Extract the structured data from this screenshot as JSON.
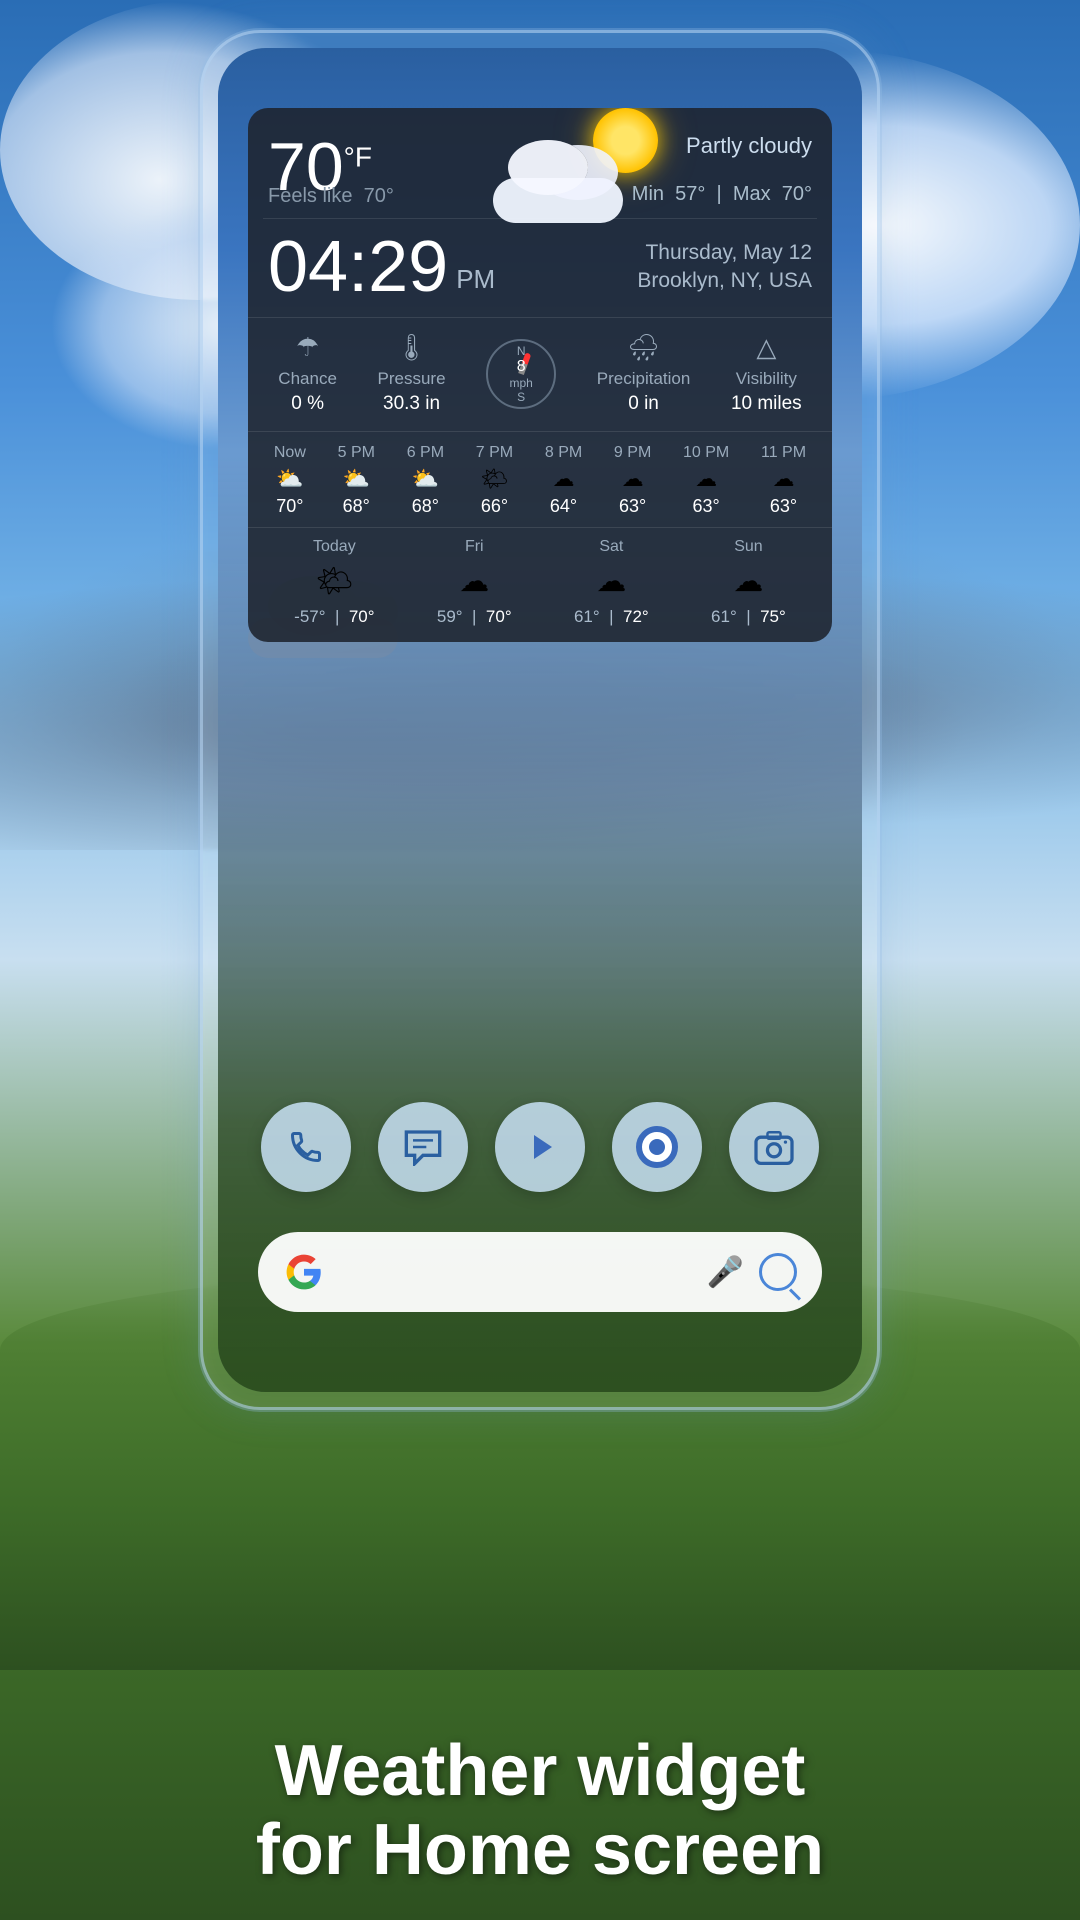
{
  "background": {
    "description": "Landscape with blue sky, clouds, and green hills"
  },
  "weather_widget": {
    "temperature": "70",
    "unit": "°F",
    "condition": "Partly cloudy",
    "feels_like_label": "Feels like",
    "feels_like_temp": "70°",
    "min_label": "Min",
    "min_temp": "57°",
    "max_label": "Max",
    "max_temp": "70°",
    "time": "04:29",
    "ampm": "PM",
    "date": "Thursday, May 12",
    "location": "Brooklyn, NY, USA",
    "stats": {
      "chance_label": "Chance",
      "chance_value": "0 %",
      "pressure_label": "Pressure",
      "pressure_value": "30.3 in",
      "wind_speed": "8",
      "wind_unit": "mph",
      "precipitation_label": "Precipitation",
      "precipitation_value": "0 in",
      "visibility_label": "Visibility",
      "visibility_value": "10 miles"
    },
    "hourly": [
      {
        "label": "Now",
        "icon": "⛅",
        "temp": "70°"
      },
      {
        "label": "5 PM",
        "icon": "⛅",
        "temp": "68°"
      },
      {
        "label": "6 PM",
        "icon": "⛅",
        "temp": "68°"
      },
      {
        "label": "7 PM",
        "icon": "🌤",
        "temp": "66°"
      },
      {
        "label": "8 PM",
        "icon": "☁",
        "temp": "64°"
      },
      {
        "label": "9 PM",
        "icon": "☁",
        "temp": "63°"
      },
      {
        "label": "10 PM",
        "icon": "☁",
        "temp": "63°"
      },
      {
        "label": "11 PM",
        "icon": "☁",
        "temp": "63°"
      }
    ],
    "daily": [
      {
        "label": "Today",
        "icon": "🌤",
        "low": "-57°",
        "high": "70°"
      },
      {
        "label": "Fri",
        "icon": "☁",
        "low": "59°",
        "high": "70°"
      },
      {
        "label": "Sat",
        "icon": "☁",
        "low": "61°",
        "high": "72°"
      },
      {
        "label": "Sun",
        "icon": "☁",
        "low": "61°",
        "high": "75°"
      }
    ]
  },
  "dock": {
    "icons": [
      {
        "name": "phone-icon",
        "symbol": "📞"
      },
      {
        "name": "messages-icon",
        "symbol": "💬"
      },
      {
        "name": "play-store-icon",
        "symbol": "▶"
      },
      {
        "name": "chrome-icon",
        "symbol": "◎"
      },
      {
        "name": "camera-icon",
        "symbol": "📷"
      }
    ]
  },
  "search_bar": {
    "placeholder": ""
  },
  "bottom_text": {
    "line1": "Weather widget",
    "line2": "for Home screen"
  }
}
